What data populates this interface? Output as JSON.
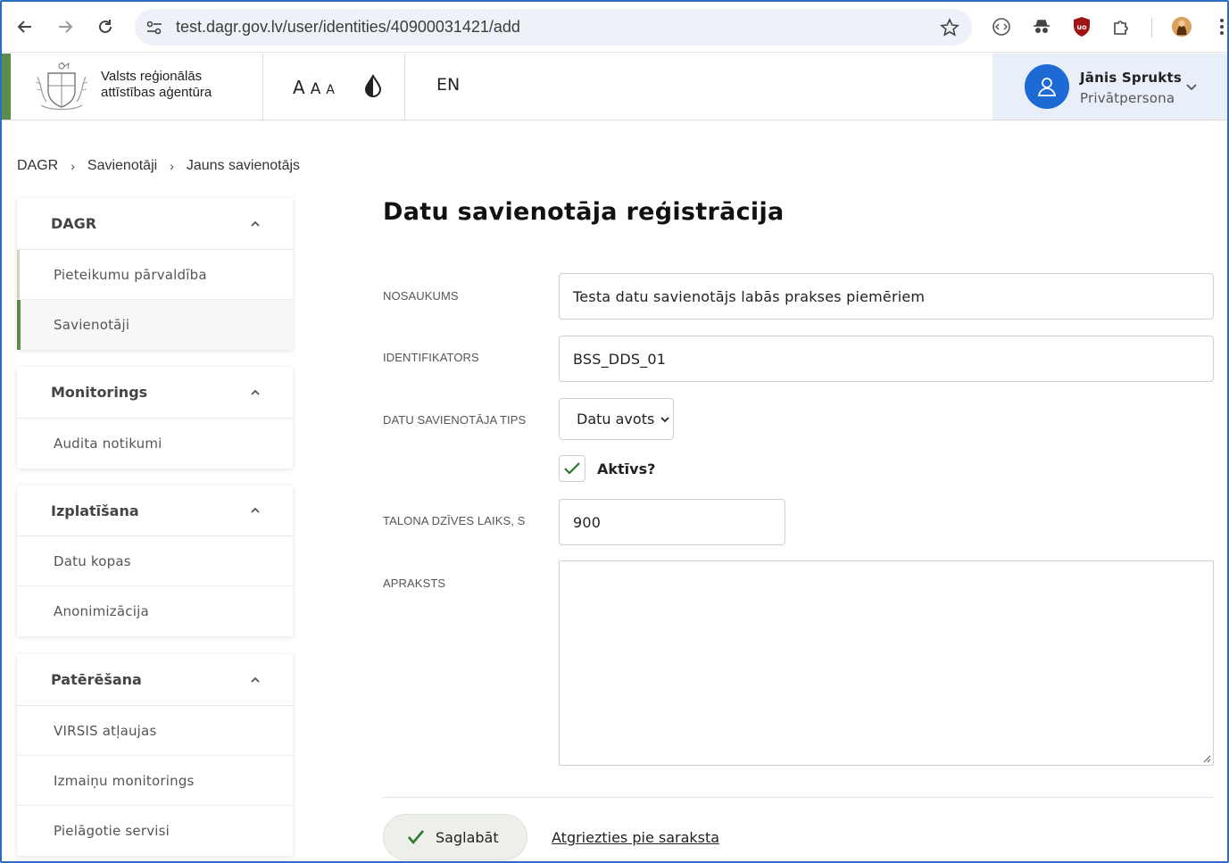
{
  "browser": {
    "url": "test.dagr.gov.lv/user/identities/40900031421/add"
  },
  "header": {
    "agency_line1": "Valsts reģionālās",
    "agency_line2": "attīstības aģentūra",
    "font_sizes": [
      "A",
      "A",
      "A"
    ],
    "language": "EN",
    "user_name": "Jānis Sprukts",
    "user_role": "Privātpersona"
  },
  "breadcrumb": [
    "DAGR",
    "Savienotāji",
    "Jauns savienotājs"
  ],
  "sidebar": {
    "groups": [
      {
        "title": "DAGR",
        "items": [
          "Pieteikumu pārvaldība",
          "Savienotāji"
        ]
      },
      {
        "title": "Monitorings",
        "items": [
          "Audita notikumi"
        ]
      },
      {
        "title": "Izplatīšana",
        "items": [
          "Datu kopas",
          "Anonimizācija"
        ]
      },
      {
        "title": "Patērēšana",
        "items": [
          "VIRSIS atļaujas",
          "Izmaiņu monitorings",
          "Pielāgotie servisi"
        ]
      }
    ],
    "active_item": "Savienotāji"
  },
  "form": {
    "title": "Datu savienotāja reģistrācija",
    "name_label": "NOSAUKUMS",
    "name_value": "Testa datu savienotājs labās prakses piemēriem",
    "id_label": "IDENTIFIKATORS",
    "id_value": "BSS_DDS_01",
    "type_label": "DATU SAVIENOTĀJA TIPS",
    "type_value": "Datu avots",
    "active_label": "Aktīvs?",
    "active_checked": true,
    "ttl_label": "TALONA DZĪVES LAIKS, S",
    "ttl_value": "900",
    "description_label": "APRAKSTS",
    "description_value": "",
    "save_label": "Saglabāt",
    "back_label": "Atgriezties pie saraksta"
  },
  "colors": {
    "accent_green": "#5b8c4c",
    "user_avatar_blue": "#1e6ad4",
    "user_box_bg": "#e8eff9"
  }
}
